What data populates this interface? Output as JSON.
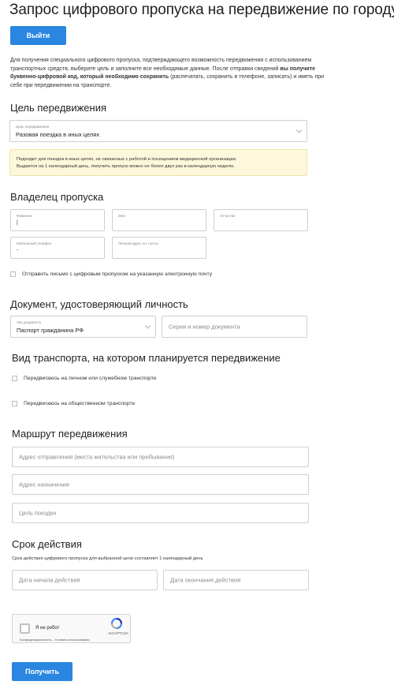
{
  "page": {
    "title": "Запрос цифрового пропуска на передвижение по городу",
    "logout_label": "Выйти",
    "intro_part1": "Для получения специального цифрового пропуска, подтверждающего возможность передвижения с использованием транспортных средств, выберите цель и заполните все необходимые данные. После отправки сведений ",
    "intro_bold": "вы получите буквенно-цифровой код, который необходимо сохранить",
    "intro_part2": " (распечатать, сохранить в телефоне, записать) и иметь при себе при передвижении на транспорте.",
    "submit_label": "Получить"
  },
  "purpose": {
    "heading": "Цель передвижения",
    "select_label": "Цель передвижения",
    "select_value": "Разовая поездка в иных целях",
    "note_line1": "Подходит для поездок в иных целях, не связанных с работой и посещением медицинской организации.",
    "note_line2": "Выдается на 1 календарный день, получить пропуск можно не более двух раз в календарную неделю."
  },
  "owner": {
    "heading": "Владелец пропуска",
    "lastname_label": "Фамилия",
    "lastname_value": "|",
    "firstname_label": "Имя",
    "patronymic_label": "Отчество",
    "phone_label": "Мобильный телефон",
    "phone_value": "-",
    "email_label": "Личный адрес эл. почты",
    "send_email_label": "Отправить письмо с цифровым пропуском на указанную электронную почту"
  },
  "document": {
    "heading": "Документ, удостоверяющий личность",
    "type_label": "Тип документа",
    "type_value": "Паспорт гражданина РФ",
    "number_placeholder": "Серия и номер документа"
  },
  "transport": {
    "heading": "Вид транспорта, на котором планируется передвижение",
    "option_personal": "Передвигаюсь на личном или служебном транспорте",
    "option_public": "Передвигаюсь на общественном транспорте"
  },
  "route": {
    "heading": "Маршрут передвижения",
    "from_placeholder": "Адрес отправления (места жительства или пребывания)",
    "to_placeholder": "Адрес назначения",
    "purpose_placeholder": "Цель поездки"
  },
  "validity": {
    "heading": "Срок действия",
    "note": "Срок действия цифрового пропуска для выбранной цели составляет 1 календарный день",
    "start_placeholder": "Дата начала действия",
    "end_placeholder": "Дата окончания действия"
  },
  "captcha": {
    "label": "Я не робот",
    "brand": "reCAPTCHA",
    "links": "Конфиденциальность - Условия использования"
  },
  "colors": {
    "accent": "#2a86e0",
    "note_bg": "#fdf7dc"
  }
}
